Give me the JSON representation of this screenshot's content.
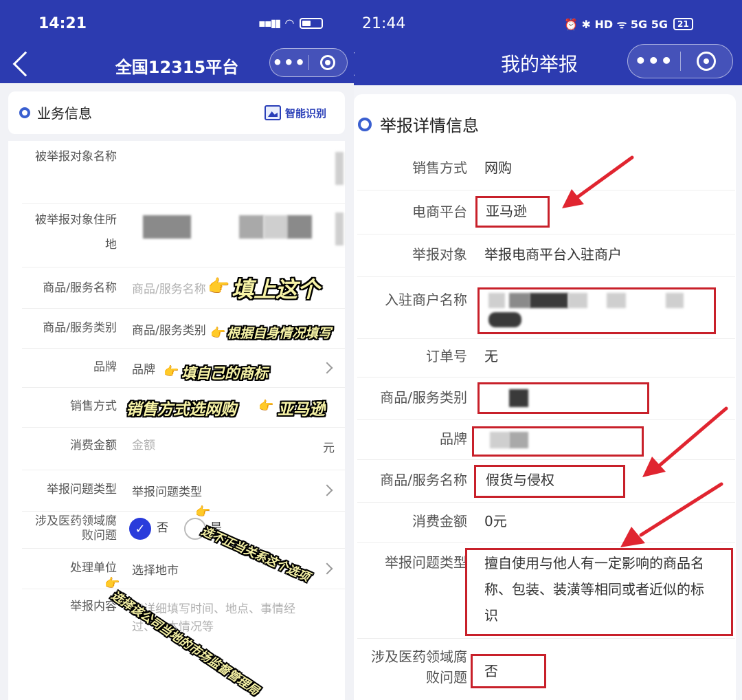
{
  "left": {
    "status": {
      "time": "14:21"
    },
    "nav": {
      "title": "全国12315平台",
      "capsule_more": "•••"
    },
    "section": {
      "title": "业务信息",
      "smart_label": "智能识别"
    },
    "rows": {
      "target_name": {
        "label": "被举报对象名称"
      },
      "target_address": {
        "label_line1": "被举报对象住所",
        "label_line2": "地"
      },
      "product_name": {
        "label": "商品/服务名称",
        "placeholder": "商品/服务名称"
      },
      "product_category": {
        "label": "商品/服务类别",
        "placeholder": "商品/服务类别"
      },
      "brand": {
        "label": "品牌",
        "placeholder": "品牌"
      },
      "sale_method": {
        "label": "销售方式"
      },
      "amount": {
        "label": "消费金额",
        "placeholder": "金额",
        "unit": "元"
      },
      "issue_type": {
        "label": "举报问题类型",
        "placeholder": "举报问题类型"
      },
      "medical": {
        "label_line1": "涉及医药领域腐",
        "label_line2": "败问题",
        "no": "否",
        "yes": "是"
      },
      "handler": {
        "label": "处理单位",
        "placeholder": "选择地市"
      },
      "content": {
        "label": "举报内容",
        "placeholder_line1": "请详细填写时间、地点、事情经",
        "placeholder_line2": "过、基本情况等"
      }
    },
    "annotations": {
      "fill_this": "填上这个",
      "fill_own": "根据自身情况填写",
      "fill_brand": "填自己的商标",
      "sale_online": "销售方式选网购",
      "amazon": "亚马逊",
      "choose_no": "选不正当关系这个选项",
      "choose_city": "选择该公司当地的市场监督管理局"
    }
  },
  "right": {
    "status": {
      "time": "21:44",
      "icons": "⏰ ✱ HD ᯤ 5G 5G",
      "battery": "21"
    },
    "nav": {
      "title": "我的举报",
      "capsule_more": "•••"
    },
    "section": {
      "title": "举报详情信息"
    },
    "rows": {
      "sale_method": {
        "label": "销售方式",
        "value": "网购"
      },
      "platform": {
        "label": "电商平台",
        "value": "亚马逊"
      },
      "target": {
        "label": "举报对象",
        "value": "举报电商平台入驻商户"
      },
      "merchant": {
        "label": "入驻商户名称"
      },
      "order": {
        "label": "订单号",
        "value": "无"
      },
      "category": {
        "label": "商品/服务类别"
      },
      "brand": {
        "label": "品牌"
      },
      "product": {
        "label": "商品/服务名称",
        "value": "假货与侵权"
      },
      "amount": {
        "label": "消费金额",
        "value": "0元"
      },
      "issue_type": {
        "label": "举报问题类型",
        "value_line1": "擅自使用与他人有一定影响的商品名",
        "value_line2": "称、包装、装潢等相同或者近似的标",
        "value_line3": "识"
      },
      "medical": {
        "label_line1": "涉及医药领域腐",
        "label_line2": "败问题",
        "value": "否"
      }
    }
  },
  "colors": {
    "header": "#2c3bb0",
    "accent": "#2a3cdb",
    "highlight": "#c8202a",
    "annotation": "#f7f3a6"
  },
  "icons": [
    "back-icon",
    "more-icon",
    "close-target-icon",
    "smart-recognize-icon",
    "chevron-right-icon",
    "check-icon",
    "pointing-hand-icon",
    "red-arrow-icon"
  ]
}
